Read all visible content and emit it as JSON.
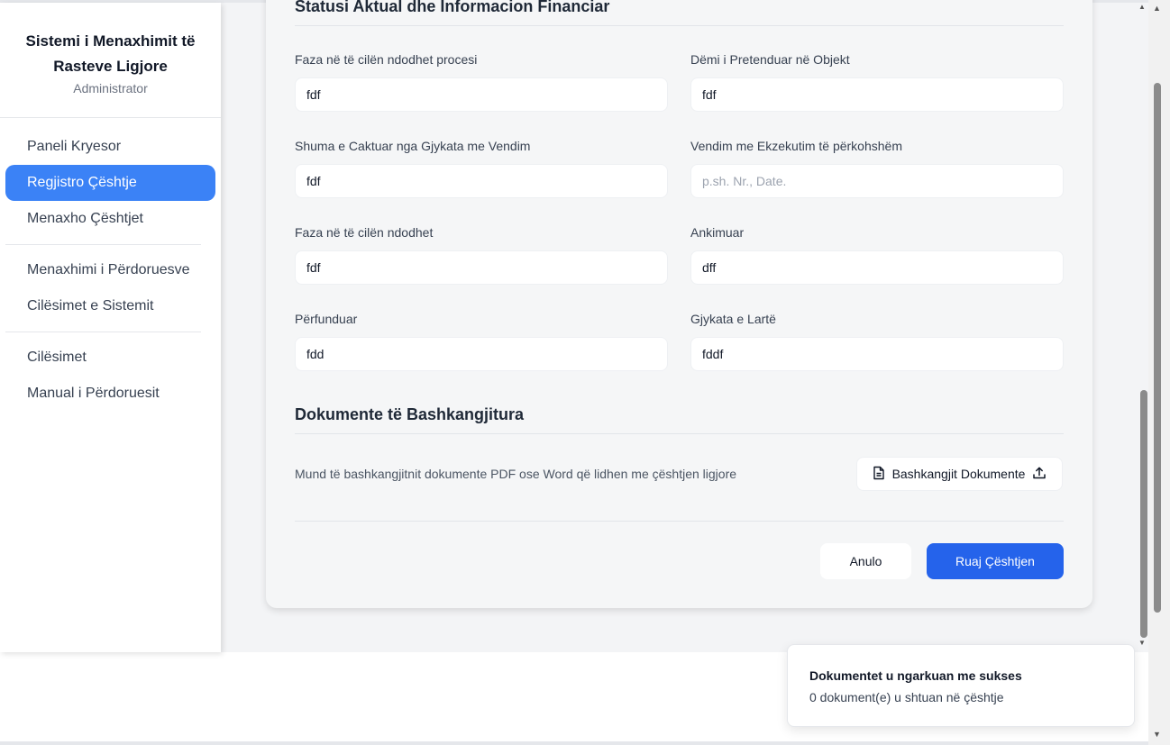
{
  "sidebar": {
    "title": "Sistemi i Menaxhimit të Rasteve Ligjore",
    "role": "Administrator",
    "items": [
      {
        "label": "Paneli Kryesor"
      },
      {
        "label": "Regjistro Çështje"
      },
      {
        "label": "Menaxho Çështjet"
      },
      {
        "label": "Menaxhimi i Përdoruesve"
      },
      {
        "label": "Cilësimet e Sistemit"
      },
      {
        "label": "Cilësimet"
      },
      {
        "label": "Manual i Përdoruesit"
      }
    ],
    "active_item": "Regjistro Çështje",
    "accent_color": "#3b82f6"
  },
  "form": {
    "section_title": "Statusi Aktual dhe Informacion Financiar",
    "fields": [
      {
        "label": "Faza në të cilën ndodhet procesi",
        "value": "fdf",
        "placeholder": ""
      },
      {
        "label": "Dëmi i Pretenduar në Objekt",
        "value": "fdf",
        "placeholder": ""
      },
      {
        "label": "Shuma e Caktuar nga Gjykata me Vendim",
        "value": "fdf",
        "placeholder": ""
      },
      {
        "label": "Vendim me Ekzekutim të përkohshëm",
        "value": "",
        "placeholder": "p.sh. Nr., Date."
      },
      {
        "label": "Faza në të cilën ndodhet",
        "value": "fdf",
        "placeholder": ""
      },
      {
        "label": "Ankimuar",
        "value": "dff",
        "placeholder": ""
      },
      {
        "label": "Përfunduar",
        "value": "fdd",
        "placeholder": ""
      },
      {
        "label": "Gjykata e Lartë",
        "value": "fddf",
        "placeholder": ""
      }
    ]
  },
  "documents": {
    "title": "Dokumente të Bashkangjitura",
    "hint": "Mund të bashkangjitnit dokumente PDF ose Word që lidhen me çështjen ligjore",
    "attach_label": "Bashkangjit Dokumente",
    "file_icon": "file-icon",
    "upload_icon": "upload-icon"
  },
  "actions": {
    "cancel_label": "Anulo",
    "save_label": "Ruaj Çështjen",
    "save_color": "#2563eb"
  },
  "toast": {
    "title": "Dokumentet u ngarkuan me sukses",
    "message": "0 dokument(e) u shtuan në çështje"
  }
}
